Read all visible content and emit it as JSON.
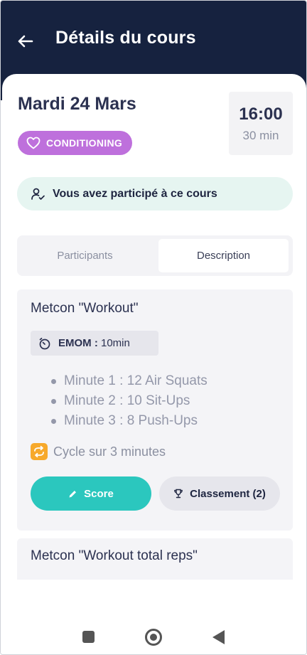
{
  "header": {
    "title": "Détails du cours",
    "back_icon": "arrow-left-icon"
  },
  "course": {
    "date": "Mardi 24 Mars",
    "time": "16:00",
    "duration": "30 min",
    "category": "CONDITIONING",
    "category_icon": "heart-icon",
    "category_color": "#be70dc"
  },
  "participation": {
    "text": "Vous avez participé à ce cours",
    "icon": "user-check-icon"
  },
  "tabs": [
    {
      "label": "Participants",
      "active": false
    },
    {
      "label": "Description",
      "active": true
    }
  ],
  "workouts": [
    {
      "title": "Metcon \"Workout\"",
      "timer_icon": "timer-icon",
      "format": "EMOM :",
      "format_detail": "10min",
      "movements": [
        "Minute 1 : 12 Air Squats",
        "Minute 2 : 10 Sit-Ups",
        "Minute 3 : 8 Push-Ups"
      ],
      "note": "Cycle sur 3 minutes",
      "note_icon": "repeat-icon",
      "score_button": "Score",
      "ranking_button": "Classement (2)"
    },
    {
      "title": "Metcon \"Workout total reps\""
    }
  ],
  "colors": {
    "header_bg": "#16223f",
    "accent_teal": "#2bc7be",
    "participation_bg": "#e6f5f1"
  }
}
